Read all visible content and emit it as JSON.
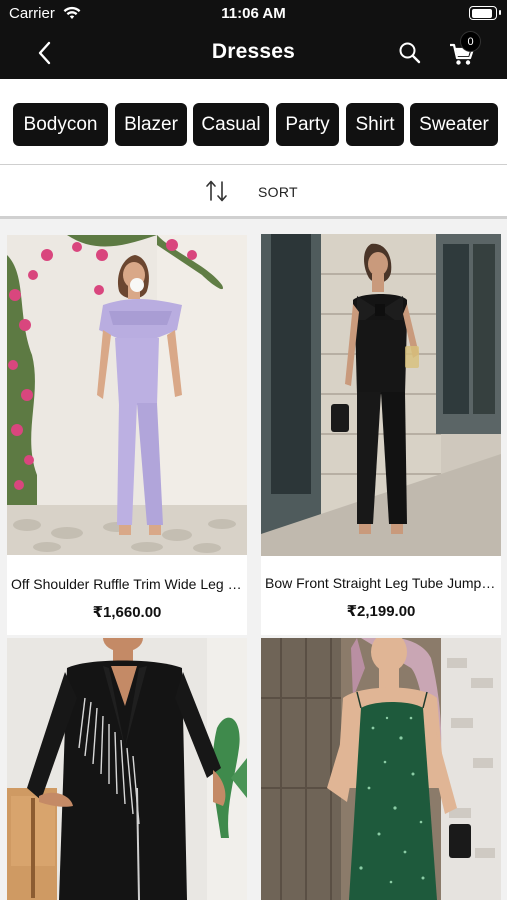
{
  "status_bar": {
    "carrier": "Carrier",
    "time": "11:06 AM",
    "battery_level": 0.95
  },
  "nav": {
    "title": "Dresses",
    "cart_count": "0",
    "icons": [
      "back-chevron-icon",
      "search-icon",
      "cart-icon"
    ]
  },
  "categories": [
    {
      "label": "Bodycon"
    },
    {
      "label": "Blazer"
    },
    {
      "label": "Casual"
    },
    {
      "label": "Party"
    },
    {
      "label": "Shirt"
    },
    {
      "label": "Sweater"
    }
  ],
  "sort": {
    "label": "SORT",
    "icon": "sort-arrows-icon"
  },
  "products": [
    {
      "name": "Off Shoulder Ruffle Trim Wide Leg Jumpsuit",
      "price": "₹1,660.00"
    },
    {
      "name": "Bow Front Straight Leg Tube Jumpsuit",
      "price": "₹2,199.00"
    },
    {
      "name": "",
      "price": ""
    },
    {
      "name": "",
      "price": ""
    }
  ],
  "colors": {
    "bar_bg": "#111111",
    "chip_bg": "#111111",
    "accent_text": "#ffffff"
  }
}
